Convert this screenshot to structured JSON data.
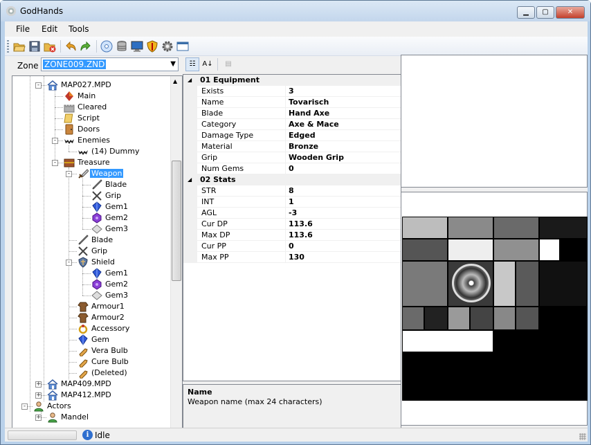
{
  "window": {
    "title": "GodHands"
  },
  "menu": [
    "File",
    "Edit",
    "Tools"
  ],
  "toolbar_icons": [
    "open-folder-icon",
    "save-icon",
    "close-file-icon",
    "undo-icon",
    "redo-icon",
    "disc-icon",
    "database-icon",
    "monitor-icon",
    "shield-icon",
    "gear-icon",
    "window-icon"
  ],
  "zone": {
    "label": "Zone",
    "value": "ZONE009.ZND"
  },
  "tree": [
    {
      "label": "MAP027.MPD",
      "icon": "house-icon",
      "exp": "-"
    },
    {
      "label": "Main",
      "icon": "diamond-icon"
    },
    {
      "label": "Cleared",
      "icon": "castle-icon"
    },
    {
      "label": "Script",
      "icon": "scroll-icon"
    },
    {
      "label": "Doors",
      "icon": "door-icon"
    },
    {
      "label": "Enemies",
      "icon": "bat-icon",
      "exp": "-"
    },
    {
      "label": "(14) Dummy",
      "icon": "bat-icon"
    },
    {
      "label": "Treasure",
      "icon": "chest-icon",
      "exp": "-"
    },
    {
      "label": "Weapon",
      "icon": "sword-icon",
      "exp": "-",
      "selected": true
    },
    {
      "label": "Blade",
      "icon": "blade-icon"
    },
    {
      "label": "Grip",
      "icon": "grip-icon"
    },
    {
      "label": "Gem1",
      "icon": "gem-blue-icon"
    },
    {
      "label": "Gem2",
      "icon": "gem-purple-icon"
    },
    {
      "label": "Gem3",
      "icon": "gem-gray-icon"
    },
    {
      "label": "Blade",
      "icon": "blade-icon"
    },
    {
      "label": "Grip",
      "icon": "grip-icon"
    },
    {
      "label": "Shield",
      "icon": "shield-icon",
      "exp": "-"
    },
    {
      "label": "Gem1",
      "icon": "gem-blue-icon"
    },
    {
      "label": "Gem2",
      "icon": "gem-purple-icon"
    },
    {
      "label": "Gem3",
      "icon": "gem-gray-icon"
    },
    {
      "label": "Armour1",
      "icon": "armour-icon"
    },
    {
      "label": "Armour2",
      "icon": "armour-icon"
    },
    {
      "label": "Accessory",
      "icon": "ring-icon"
    },
    {
      "label": "Gem",
      "icon": "gem-blue-icon"
    },
    {
      "label": "Vera Bulb",
      "icon": "bulb-icon"
    },
    {
      "label": "Cure Bulb",
      "icon": "bulb-icon"
    },
    {
      "label": "(Deleted)",
      "icon": "bulb-icon"
    },
    {
      "label": "MAP409.MPD",
      "icon": "house-icon",
      "exp": "+"
    },
    {
      "label": "MAP412.MPD",
      "icon": "house-icon",
      "exp": "+"
    },
    {
      "label": "Actors",
      "icon": "person-icon",
      "exp": "-"
    },
    {
      "label": "Mandel",
      "icon": "person-icon",
      "exp": "+"
    }
  ],
  "properties": {
    "categories": [
      {
        "title": "01 Equipment",
        "rows": [
          {
            "k": "Exists",
            "v": "3"
          },
          {
            "k": "Name",
            "v": "Tovarisch"
          },
          {
            "k": "Blade",
            "v": "Hand Axe"
          },
          {
            "k": "Category",
            "v": "Axe & Mace"
          },
          {
            "k": "Damage Type",
            "v": "Edged"
          },
          {
            "k": "Material",
            "v": "Bronze"
          },
          {
            "k": "Grip",
            "v": "Wooden Grip"
          },
          {
            "k": "Num Gems",
            "v": "0"
          }
        ]
      },
      {
        "title": "02 Stats",
        "rows": [
          {
            "k": "STR",
            "v": "8"
          },
          {
            "k": "INT",
            "v": "1"
          },
          {
            "k": "AGL",
            "v": "-3"
          },
          {
            "k": "Cur DP",
            "v": "113.6"
          },
          {
            "k": "Max DP",
            "v": "113.6"
          },
          {
            "k": "Cur PP",
            "v": "0"
          },
          {
            "k": "Max PP",
            "v": "130"
          }
        ]
      }
    ]
  },
  "description": {
    "title": "Name",
    "body": "Weapon name (max 24 characters)"
  },
  "status": {
    "text": "Idle"
  }
}
